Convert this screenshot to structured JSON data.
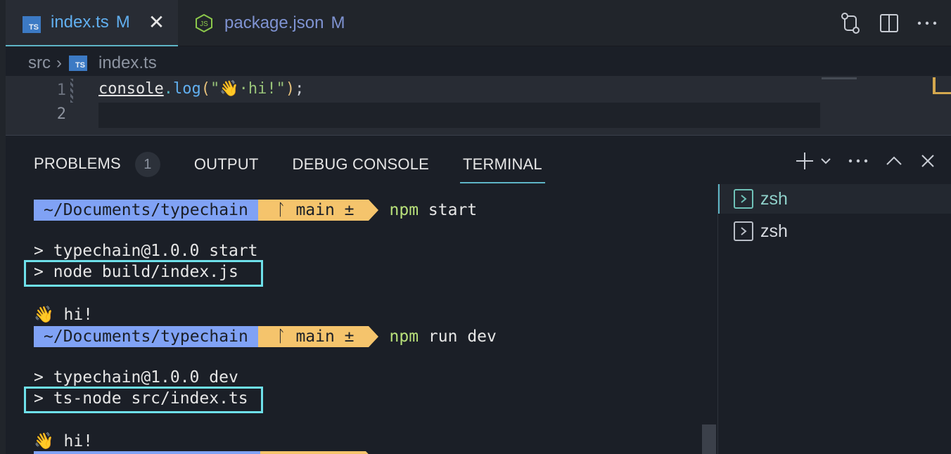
{
  "tabs": [
    {
      "name": "index.ts",
      "modified": "M",
      "icon": "ts-icon",
      "active": true
    },
    {
      "name": "package.json",
      "modified": "M",
      "icon": "nodejs-icon",
      "active": false
    }
  ],
  "editor_actions": [
    "source-control-icon",
    "split-editor-icon",
    "more-icon"
  ],
  "breadcrumb": {
    "folder": "src",
    "file": "index.ts"
  },
  "editor": {
    "line_numbers": [
      "1",
      "2"
    ],
    "code": {
      "obj": "console",
      "dot": ".",
      "fn": "log",
      "open": "(",
      "str": "\"👋·hi!\"",
      "close": ")",
      "end": ";"
    }
  },
  "panel": {
    "tabs": [
      "PROBLEMS",
      "OUTPUT",
      "DEBUG CONSOLE",
      "TERMINAL"
    ],
    "problems_count": "1",
    "active_tab": "TERMINAL"
  },
  "terminal": {
    "prompt1": {
      "path": "~/Documents/typechain",
      "git": "ᛚ main ±",
      "cmd_bin": "npm",
      "cmd_args": " start"
    },
    "out1a": "> typechain@1.0.0 start",
    "out1b": "> node build/index.js",
    "out1c": "👋 hi!",
    "prompt2": {
      "path": "~/Documents/typechain",
      "git": "ᛚ main ±",
      "cmd_bin": "npm",
      "cmd_args": " run dev"
    },
    "out2a": "> typechain@1.0.0 dev",
    "out2b": "> ts-node src/index.ts",
    "out2c": "👋 hi!"
  },
  "terminals": [
    {
      "label": "zsh",
      "selected": true
    },
    {
      "label": "zsh",
      "selected": false
    }
  ],
  "colors": {
    "accent": "#5eb5c6",
    "path_segment": "#80a2f5",
    "git_segment": "#f5c46c",
    "highlight_box": "#6ee0ea"
  }
}
